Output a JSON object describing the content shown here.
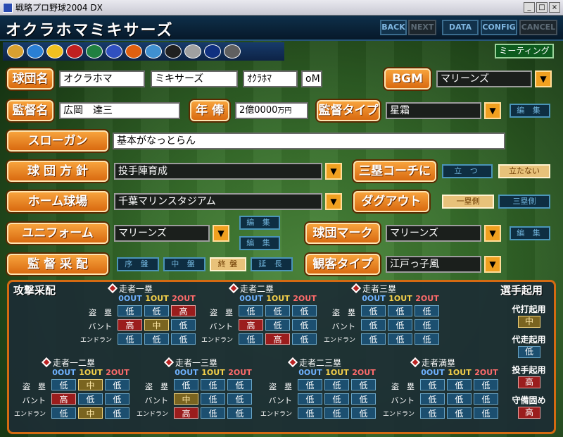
{
  "window": {
    "title": "戦略プロ野球2004 DX",
    "minimize": "_",
    "maximize": "□",
    "close": "×"
  },
  "header": {
    "team_name": "オクラホマミキサーズ"
  },
  "nav": {
    "back": "BACK",
    "next": "NEXT",
    "data": "DATA",
    "config": "CONFIG",
    "cancel": "CANCEL"
  },
  "logos": [
    "team-logo-1",
    "team-logo-2",
    "team-logo-3",
    "team-logo-4",
    "team-logo-5",
    "team-logo-6",
    "team-logo-7",
    "team-logo-8",
    "team-logo-9",
    "team-logo-10",
    "team-logo-11",
    "team-logo-12"
  ],
  "meeting": "ミーティング",
  "form": {
    "team_name_label": "球団名",
    "team_city": "オクラホマ",
    "team_nick": "ミキサーズ",
    "team_short": "ｵｸﾗﾎﾏ",
    "team_abbr": "oM",
    "bgm_label": "BGM",
    "bgm_value": "マリーンズ",
    "manager_label": "監督名",
    "manager_name": "広岡　達三",
    "salary_label": "年 俸",
    "salary_value": "2億0000",
    "salary_unit": "万円",
    "manager_type_label": "監督タイプ",
    "manager_type_value": "星霜",
    "edit": "編 集",
    "slogan_label": "スローガン",
    "slogan_value": "基本がなっとらん",
    "policy_label": "球 団 方 針",
    "policy_value": "投手陣育成",
    "third_coach_label": "三塁コーチに",
    "third_coach_options": [
      "立 つ",
      "立たない"
    ],
    "home_label": "ホーム球場",
    "home_value": "千葉マリンスタジアム",
    "dugout_label": "ダグアウト",
    "dugout_options": [
      "一塁側",
      "三塁側"
    ],
    "uniform_label": "ユニフォーム",
    "uniform_value": "マリーンズ",
    "mark_label": "球団マーク",
    "mark_value": "マリーンズ",
    "tactics_label": "監 督 采 配",
    "tactics_options": [
      "序 盤",
      "中 盤",
      "終 盤",
      "延 長"
    ],
    "audience_label": "観客タイプ",
    "audience_value": "江戸っ子風"
  },
  "panel": {
    "title": "攻撃采配",
    "sub_title": "選手起用",
    "col_headers": [
      "0OUT",
      "1OUT",
      "2OUT"
    ],
    "row_labels": [
      "盗　塁",
      "バント",
      "エンドラン"
    ],
    "grids": [
      {
        "title": "走者一塁",
        "rows": [
          [
            "低",
            "低",
            "高"
          ],
          [
            "高",
            "中",
            "低"
          ],
          [
            "低",
            "低",
            "低"
          ]
        ]
      },
      {
        "title": "走者二塁",
        "rows": [
          [
            "低",
            "低",
            "低"
          ],
          [
            "高",
            "低",
            "低"
          ],
          [
            "低",
            "高",
            "低"
          ]
        ]
      },
      {
        "title": "走者三塁",
        "rows": [
          [
            "低",
            "低",
            "低"
          ],
          [
            "低",
            "低",
            "低"
          ],
          [
            "低",
            "低",
            "低"
          ]
        ]
      },
      {
        "title": "走者一二塁",
        "rows": [
          [
            "低",
            "中",
            "低"
          ],
          [
            "高",
            "低",
            "低"
          ],
          [
            "低",
            "中",
            "低"
          ]
        ]
      },
      {
        "title": "走者一三塁",
        "rows": [
          [
            "低",
            "低",
            "低"
          ],
          [
            "中",
            "低",
            "低"
          ],
          [
            "高",
            "低",
            "低"
          ]
        ]
      },
      {
        "title": "走者二三塁",
        "rows": [
          [
            "低",
            "低",
            "低"
          ],
          [
            "低",
            "低",
            "低"
          ],
          [
            "低",
            "低",
            "低"
          ]
        ]
      },
      {
        "title": "走者満塁",
        "rows": [
          [
            "低",
            "低",
            "低"
          ],
          [
            "低",
            "低",
            "低"
          ],
          [
            "低",
            "低",
            "低"
          ]
        ]
      }
    ],
    "side": [
      {
        "label": "代打起用",
        "value": "中"
      },
      {
        "label": "代走起用",
        "value": "低"
      },
      {
        "label": "投手起用",
        "value": "高"
      },
      {
        "label": "守備固め",
        "value": "高"
      }
    ]
  },
  "colors": {
    "accent": "#f0a020",
    "high": "#9b1d1d",
    "low": "#1c4f70",
    "mid": "#7a6420",
    "col_0out": "#6fb2ff",
    "col_1out": "#f5d04a",
    "col_2out": "#ff6b6b"
  }
}
